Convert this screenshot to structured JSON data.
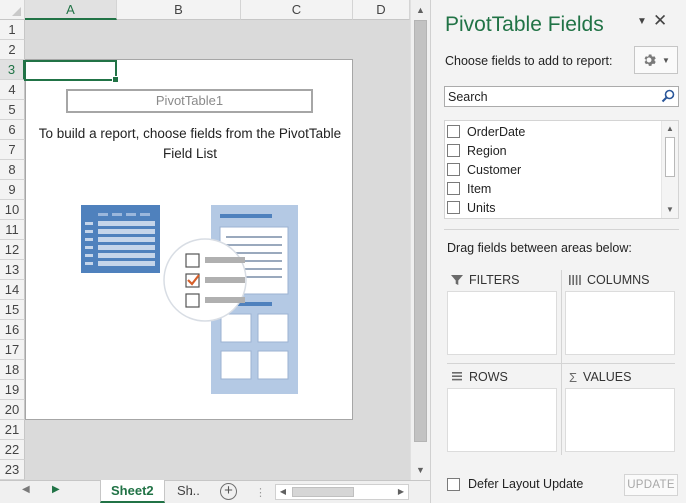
{
  "sheet": {
    "columns": [
      "A",
      "B",
      "C",
      "D"
    ],
    "rows": [
      "1",
      "2",
      "3",
      "4",
      "5",
      "6",
      "7",
      "8",
      "9",
      "10",
      "11",
      "12",
      "13",
      "14",
      "15",
      "16",
      "17",
      "18",
      "19",
      "20",
      "21",
      "22",
      "23"
    ],
    "selected_column": "A",
    "selected_row": "3"
  },
  "pivot": {
    "name": "PivotTable1",
    "instructions": "To build a report, choose fields from the PivotTable Field List"
  },
  "tabs": {
    "active": "Sheet2",
    "other": "Sh",
    "more": "...",
    "add_symbol": "+"
  },
  "pane": {
    "title": "PivotTable Fields",
    "choose_label": "Choose fields to add to report:",
    "search_placeholder": "Search",
    "fields": [
      "OrderDate",
      "Region",
      "Customer",
      "Item",
      "Units"
    ],
    "drag_label": "Drag fields between areas below:",
    "areas": {
      "filters": "FILTERS",
      "columns": "COLUMNS",
      "rows": "ROWS",
      "values": "VALUES"
    },
    "defer_label": "Defer Layout Update",
    "update_label": "UPDATE"
  },
  "icons": {
    "gear": "gear-icon",
    "search": "search-icon",
    "close": "close-icon",
    "filter": "filter-icon",
    "columns": "columns-icon",
    "rows": "rows-icon",
    "sigma": "sigma-icon"
  },
  "colors": {
    "accent": "#217346",
    "illustration_blue": "#4f81bd",
    "check_orange": "#d65f2a"
  }
}
